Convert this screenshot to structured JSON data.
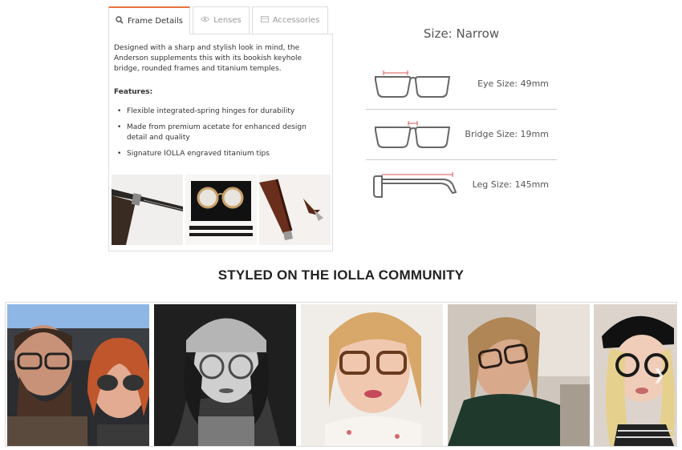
{
  "tabs": [
    {
      "label": "Frame Details",
      "icon": "search-icon",
      "active": true
    },
    {
      "label": "Lenses",
      "icon": "eye-icon",
      "active": false
    },
    {
      "label": "Accessories",
      "icon": "case-icon",
      "active": false
    }
  ],
  "details": {
    "description": "Designed with a sharp and stylish look in mind, the Anderson supplements this with its bookish keyhole bridge, rounded frames and titanium temples.",
    "features_heading": "Features:",
    "features": [
      "Flexible integrated-spring hinges for durability",
      "Made from premium acetate for enhanced design detail and quality",
      "Signature IOLLA engraved titanium tips"
    ]
  },
  "size_chart": {
    "title": "Size: Narrow",
    "rows": [
      {
        "label": "Eye Size: 49mm",
        "icon": "glasses-front-icon"
      },
      {
        "label": "Bridge Size: 19mm",
        "icon": "glasses-front-icon"
      },
      {
        "label": "Leg Size: 145mm",
        "icon": "glasses-side-icon"
      }
    ]
  },
  "community": {
    "title": "STYLED ON THE IOLLA COMMUNITY",
    "next_icon": "chevron-right-icon"
  },
  "colors": {
    "accent": "#e6733b",
    "measure_line": "#d9534f"
  }
}
